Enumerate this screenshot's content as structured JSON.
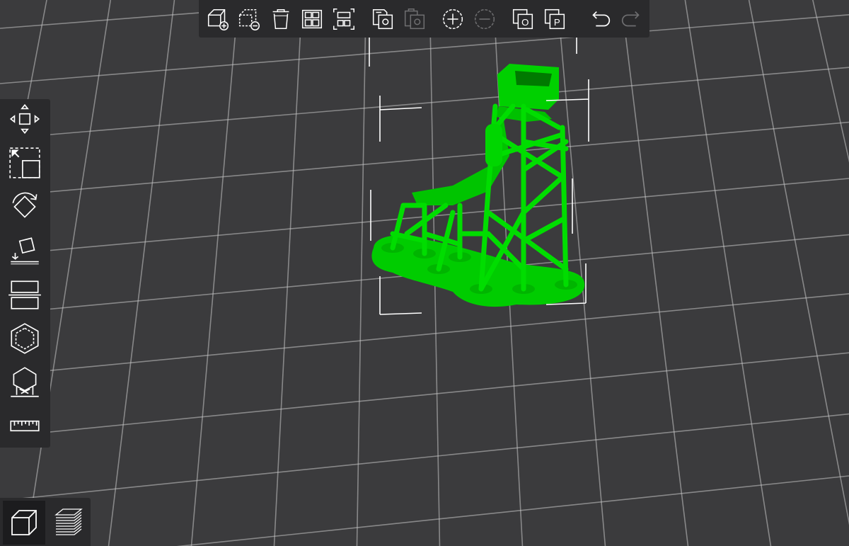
{
  "app": {
    "accent_color": "#00dd00",
    "grid_color": "#c9c9c9",
    "background_color": "#3b3b3d",
    "toolbar_color": "#2a2a2c"
  },
  "top_toolbar": {
    "items": [
      {
        "name": "add-model",
        "icon": "cube-plus-icon",
        "enabled": true
      },
      {
        "name": "remove-model",
        "icon": "cube-minus-icon",
        "enabled": true
      },
      {
        "name": "delete",
        "icon": "trash-icon",
        "enabled": true
      },
      {
        "name": "arrange",
        "icon": "layout-icon",
        "enabled": true
      },
      {
        "name": "auto-layout",
        "icon": "auto-layout-icon",
        "enabled": true
      },
      {
        "name": "copy",
        "icon": "copy-icon",
        "enabled": true
      },
      {
        "name": "paste",
        "icon": "paste-icon",
        "enabled": false
      },
      {
        "name": "zoom-in",
        "icon": "plus-circle-icon",
        "enabled": true
      },
      {
        "name": "zoom-out",
        "icon": "minus-circle-icon",
        "enabled": false
      },
      {
        "name": "orthographic",
        "icon": "ortho-icon",
        "label": "O",
        "enabled": true
      },
      {
        "name": "perspective",
        "icon": "perspective-icon",
        "label": "P",
        "enabled": true
      },
      {
        "name": "undo",
        "icon": "undo-icon",
        "enabled": true
      },
      {
        "name": "redo",
        "icon": "redo-icon",
        "enabled": false
      }
    ]
  },
  "left_toolbar": {
    "items": [
      {
        "name": "move",
        "icon": "move-icon"
      },
      {
        "name": "scale",
        "icon": "scale-icon"
      },
      {
        "name": "rotate",
        "icon": "rotate-icon"
      },
      {
        "name": "lay-flat",
        "icon": "lay-flat-icon"
      },
      {
        "name": "mirror",
        "icon": "mirror-icon"
      },
      {
        "name": "hollow",
        "icon": "hollow-icon"
      },
      {
        "name": "supports",
        "icon": "supports-icon"
      },
      {
        "name": "measure",
        "icon": "ruler-icon"
      }
    ]
  },
  "view_switcher": {
    "items": [
      {
        "name": "model-view",
        "icon": "cube-icon",
        "active": true
      },
      {
        "name": "layer-view",
        "icon": "layers-icon",
        "active": false
      }
    ]
  }
}
